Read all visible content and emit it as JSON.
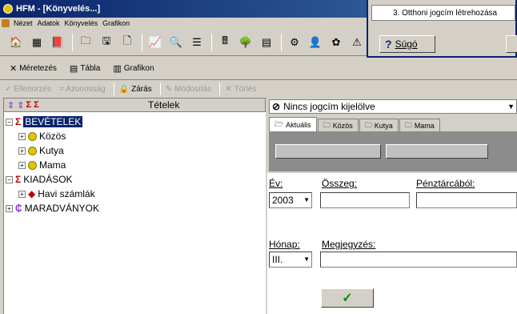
{
  "window": {
    "title": "HFM - [Könyvelés...]"
  },
  "menu": [
    "Nézet",
    "Adatok",
    "Könyvelés",
    "Grafikon"
  ],
  "view_tabs": [
    {
      "icon": "sizing-icon",
      "label": "Méretezés"
    },
    {
      "icon": "table-icon",
      "label": "Tábla"
    },
    {
      "icon": "chart-icon",
      "label": "Grafikon"
    }
  ],
  "actions": [
    {
      "label": "Ellenorzés",
      "enabled": false
    },
    {
      "label": "= Azonosság",
      "enabled": false
    },
    {
      "label": "Zárás",
      "enabled": true
    },
    {
      "label": "Módosítás",
      "enabled": false
    },
    {
      "label": "Törlés",
      "enabled": false
    }
  ],
  "tree": {
    "header": "Tételek",
    "bevetelek": "BEVÉTELEK",
    "kozos": "Közös",
    "kutya": "Kutya",
    "mama": "Mama",
    "kiadasok": "KIADÁSOK",
    "havi": "Havi számlák",
    "maradvanyok": "MARADVÁNYOK"
  },
  "detail": {
    "selector": "Nincs jogcím kijelölve",
    "tabs": [
      "Aktuális",
      "Közös",
      "Kutya",
      "Mama"
    ],
    "ev_label": "Év:",
    "ev_value": "2003",
    "osszeg_label": "Összeg:",
    "penztar_label": "Pénztárcából:",
    "honap_label": "Hónap:",
    "honap_value": "III.",
    "megjegyzes_label": "Megjegyzés:",
    "ok_symbol": "✓"
  },
  "popup": {
    "item": "3. Otthoni jogcím létrehozása",
    "help_label": "Súgó"
  },
  "colors": {
    "title_bar": "#0a246a",
    "selection": "#0a246a",
    "sigma": "#c00000",
    "tree_bg": "#ffffff"
  }
}
